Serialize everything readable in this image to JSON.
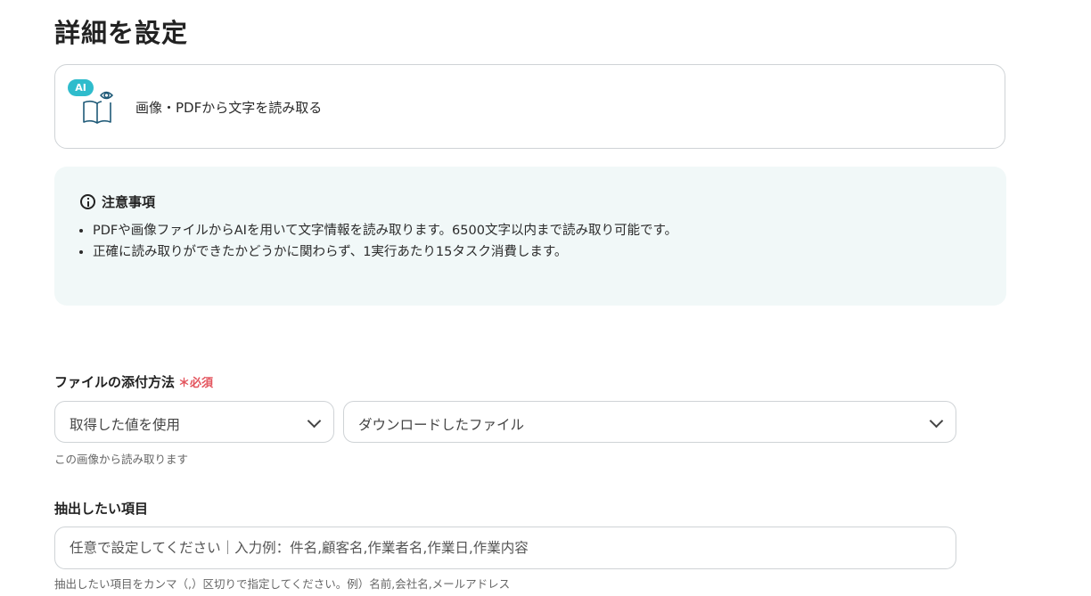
{
  "page": {
    "title": "詳細を設定"
  },
  "action": {
    "badge": "AI",
    "icon": "book-eye-icon",
    "label": "画像・PDFから文字を読み取る"
  },
  "notice": {
    "title": "注意事項",
    "items": [
      "PDFや画像ファイルからAIを用いて文字情報を読み取ります。6500文字以内まで読み取り可能です。",
      "正確に読み取りができたかどうかに関わらず、1実行あたり15タスク消費します。"
    ]
  },
  "attachment": {
    "label": "ファイルの添付方法",
    "required_mark": "＊",
    "required_text": "必須",
    "method_value": "取得した値を使用",
    "file_value": "ダウンロードしたファイル",
    "hint": "この画像から読み取ります"
  },
  "extract": {
    "label": "抽出したい項目",
    "placeholder": "任意で設定してください｜入力例：件名,顧客名,作業者名,作業日,作業内容",
    "hint": "抽出したい項目をカンマ（,）区切りで指定してください。例）名前,会社名,メールアドレス"
  },
  "colors": {
    "accent": "#2fbccc",
    "required": "#e3545d",
    "notice_bg": "#f1f8f8"
  }
}
